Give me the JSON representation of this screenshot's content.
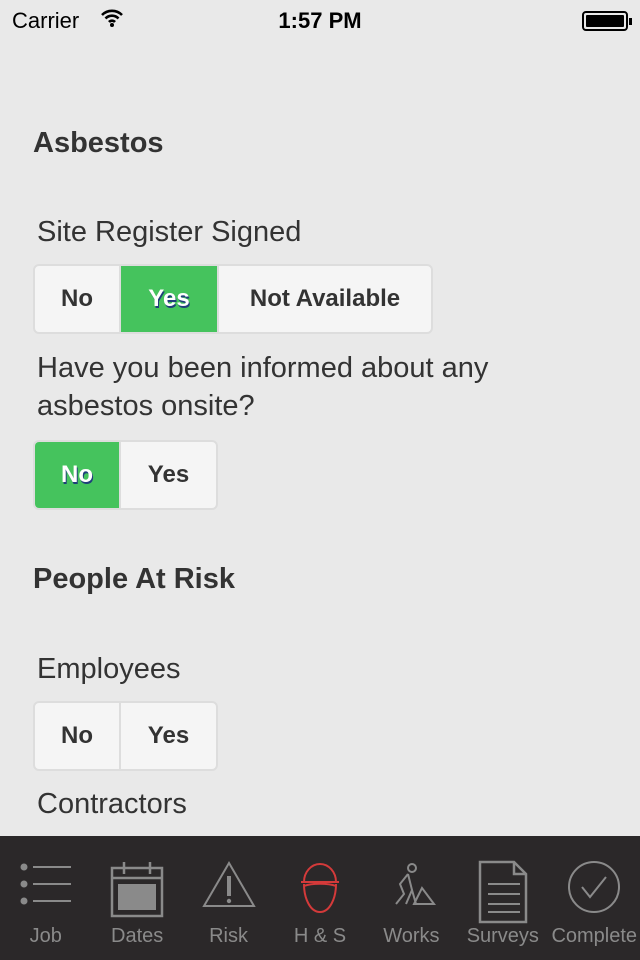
{
  "status": {
    "carrier": "Carrier",
    "time": "1:57 PM"
  },
  "sections": [
    {
      "title": "Asbestos"
    },
    {
      "title": "People At Risk"
    }
  ],
  "questions": [
    {
      "label": "Site Register Signed",
      "options": [
        "No",
        "Yes",
        "Not Available"
      ],
      "selected": "Yes"
    },
    {
      "label": "Have you been informed about any asbestos onsite?",
      "options": [
        "No",
        "Yes"
      ],
      "selected": "No"
    },
    {
      "label": "Employees",
      "options": [
        "No",
        "Yes"
      ],
      "selected": null
    },
    {
      "label": "Contractors"
    }
  ],
  "tabs": [
    {
      "label": "Job",
      "icon": "list-icon"
    },
    {
      "label": "Dates",
      "icon": "calendar-icon"
    },
    {
      "label": "Risk",
      "icon": "warning-icon"
    },
    {
      "label": "H & S",
      "icon": "hard-hat-icon",
      "active": true
    },
    {
      "label": "Works",
      "icon": "worker-icon"
    },
    {
      "label": "Surveys",
      "icon": "document-icon"
    },
    {
      "label": "Complete",
      "icon": "check-circle-icon"
    }
  ],
  "colors": {
    "selected": "#45c35d",
    "tab_active": "#d43a3a",
    "tabbar": "#2b2829"
  }
}
